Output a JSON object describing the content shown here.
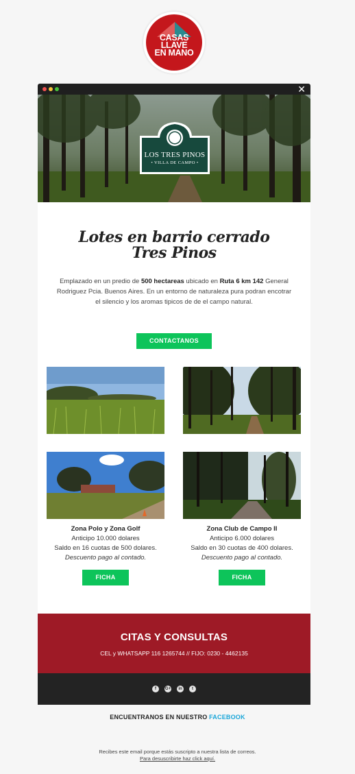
{
  "logo": {
    "line1": "CASAS",
    "line2": "LLAVE",
    "line3": "EN MANO",
    "brand_red": "#c4171c",
    "roof_red": "#e05a5a",
    "roof_teal": "#2b8a8f"
  },
  "window": {
    "close_symbol": "✕"
  },
  "hero": {
    "badge_title": "LOS TRES PINOS",
    "badge_subtitle": "• VILLA DE CAMPO •"
  },
  "headline": {
    "line1": "Lotes en barrio cerrado",
    "line2": "Tres Pinos"
  },
  "intro": {
    "part1": "Emplazado en un predio de ",
    "bold1": "500 hectareas",
    "part2": " ubicado en ",
    "bold2": "Ruta 6 km 142",
    "part3": " General Rodriguez Pcia. Buenos Aires. En un entorno de naturaleza pura podran encotrar el silencio y los aromas tipicos de de el campo natural."
  },
  "contact_button": "CONTACTANOS",
  "photos": [
    {
      "icon": "wheat-field-photo"
    },
    {
      "icon": "forest-path-photo"
    },
    {
      "icon": "farm-trees-photo"
    },
    {
      "icon": "dirt-road-photo"
    }
  ],
  "zones": [
    {
      "title": "Zona Polo y Zona Golf",
      "advance": "Anticipo 10.000 dolares",
      "balance": "Saldo en 16 cuotas de 500 dolares.",
      "discount": "Descuento pago al contado.",
      "button": "FICHA"
    },
    {
      "title": "Zona Club de Campo II",
      "advance": "Anticipo 6.000 dolares",
      "balance": "Saldo en 30 cuotas de 400 dolares.",
      "discount": "Descuento pago al contado.",
      "button": "FICHA"
    }
  ],
  "citas": {
    "title": "CITAS Y CONSULTAS",
    "phones": "CEL y WHATSAPP 116 1265744 // FIJO: 0230 - 4462135"
  },
  "social": [
    {
      "name": "facebook-icon",
      "glyph": "f"
    },
    {
      "name": "google-plus-icon",
      "glyph": "G+"
    },
    {
      "name": "linkedin-icon",
      "glyph": "in"
    },
    {
      "name": "twitter-icon",
      "glyph": "t"
    }
  ],
  "facebook_line": {
    "text": "ENCUENTRANOS EN NUESTRO ",
    "link": "FACEBOOK"
  },
  "footer": {
    "line1": "Recibes este email porque estás suscripto a nuestra lista de correos.",
    "unsubscribe": "Para desuscribirte haz click aquí."
  },
  "colors": {
    "accent_green": "#0dc45a",
    "citas_red": "#9e1a26",
    "dark_bar": "#232323",
    "link_blue": "#1aa6d9"
  }
}
